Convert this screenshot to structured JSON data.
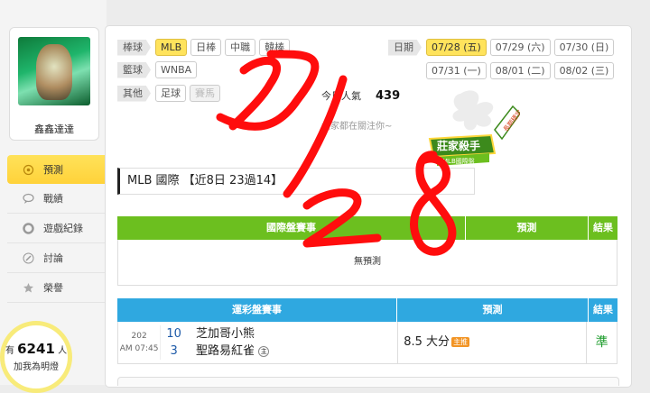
{
  "profile": {
    "name": "鑫鑫達達"
  },
  "menu": [
    {
      "label": "預測",
      "icon": "target-icon",
      "active": true
    },
    {
      "label": "戰績",
      "icon": "chat-bubble-icon"
    },
    {
      "label": "遊戲紀錄",
      "icon": "circle-icon"
    },
    {
      "label": "討論",
      "icon": "pencil-icon"
    },
    {
      "label": "榮譽",
      "icon": "medal-icon"
    }
  ],
  "fans": {
    "prefix": "有",
    "count": "6241",
    "suffix": "人",
    "cta": "加我為明燈"
  },
  "filters": {
    "baseball": {
      "label": "棒球",
      "options": [
        "MLB",
        "日棒",
        "中職",
        "韓棒"
      ],
      "selected": "MLB"
    },
    "basketball": {
      "label": "籃球",
      "options": [
        "WNBA"
      ]
    },
    "other": {
      "label": "其他",
      "options": [
        "足球",
        "賽馬"
      ],
      "disabled": "賽馬"
    },
    "date": {
      "label": "日期",
      "row1": [
        "07/28 (五)",
        "07/29 (六)",
        "07/30 (日)"
      ],
      "row2": [
        "07/31 (一)",
        "08/01 (二)",
        "08/02 (三)"
      ],
      "selected": "07/28 (五)"
    }
  },
  "popularity": {
    "label": "今日人氣",
    "value": "439",
    "subtitle": "大家都在關注你~"
  },
  "badge": {
    "title": "莊家殺手",
    "sub": "MLB國際盤",
    "ribbon": "長期穩定"
  },
  "section_title": "MLB 國際 【近8日 23過14】",
  "intl_table": {
    "headers": {
      "match": "國際盤賽事",
      "pred": "預測",
      "result": "結果"
    },
    "empty": "無預測"
  },
  "lottery_table": {
    "headers": {
      "match": "運彩盤賽事",
      "pred": "預測",
      "result": "結果"
    },
    "rows": [
      {
        "code": "202",
        "time": "AM 07:45",
        "score_away": "10",
        "score_home": "3",
        "away": "芝加哥小熊",
        "home": "聖路易紅雀",
        "home_mark": "主",
        "pick": "8.5 大分",
        "pick_tag": "主推",
        "result": "準"
      }
    ]
  },
  "overlay": {
    "text": "7/28",
    "color": "#ff0d0d"
  }
}
